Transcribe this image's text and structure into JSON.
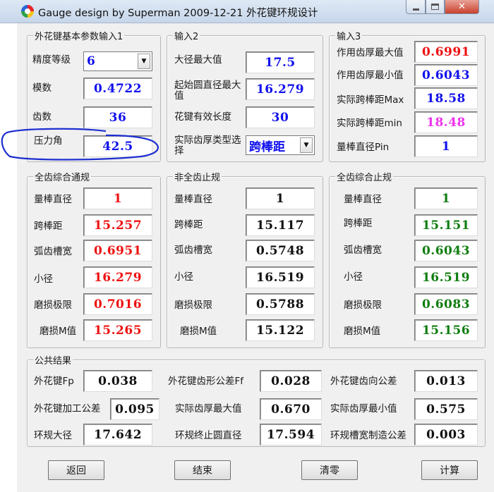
{
  "window": {
    "title": "Gauge design by Superman  2009-12-21  外花键环规设计",
    "minimize_glyph": "",
    "close_glyph": "✕"
  },
  "colors": {
    "blue": "#1010ee",
    "red": "#ee1111",
    "magenta": "#ee33ee",
    "green": "#0f7d0f",
    "annotation": "#1d2fd0"
  },
  "input1": {
    "legend": "外花键基本参数输入1",
    "precision_label": "精度等级",
    "precision_value": "6",
    "module_label": "模数",
    "module_value": "0.4722",
    "teeth_label": "齿数",
    "teeth_value": "36",
    "pressure_label": "压力角",
    "pressure_value": "42.5"
  },
  "input2": {
    "legend": "输入2",
    "major_dia_label": "大径最大值",
    "major_dia_value": "17.5",
    "start_circle_label": "起始圆直径最大值",
    "start_circle_value": "16.279",
    "length_label": "花键有效长度",
    "length_value": "30",
    "thickness_type_label": "实际齿厚类型选择",
    "thickness_type_value": "跨棒距"
  },
  "input3": {
    "legend": "输入3",
    "thick_max_label": "作用齿厚最大值",
    "thick_max_value": "0.6991",
    "thick_min_label": "作用齿厚最小值",
    "thick_min_value": "0.6043",
    "span_max_label": "实际跨棒距Max",
    "span_max_value": "18.58",
    "span_min_label": "实际跨棒距min",
    "span_min_value": "18.48",
    "pin_label": "量棒直径Pin",
    "pin_value": "1"
  },
  "go_full": {
    "legend": "全齿综合通规",
    "rows": [
      {
        "label": "量棒直径",
        "value": "1"
      },
      {
        "label": "跨棒距",
        "value": "15.257"
      },
      {
        "label": "弧齿槽宽",
        "value": "0.6951"
      },
      {
        "label": "小径",
        "value": "16.279"
      },
      {
        "label": "磨损极限",
        "value": "0.7016"
      },
      {
        "label": "磨损M值",
        "value": "15.265"
      }
    ]
  },
  "nogo_partial": {
    "legend": "非全齿止规",
    "rows": [
      {
        "label": "量棒直径",
        "value": "1"
      },
      {
        "label": "跨棒距",
        "value": "15.117"
      },
      {
        "label": "弧齿槽宽",
        "value": "0.5748"
      },
      {
        "label": "小径",
        "value": "16.519"
      },
      {
        "label": "磨损极限",
        "value": "0.5788"
      },
      {
        "label": "磨损M值",
        "value": "15.122"
      }
    ]
  },
  "nogo_full": {
    "legend": "全齿综合止规",
    "rows": [
      {
        "label": "量棒直径",
        "value": "1"
      },
      {
        "label": "跨棒距",
        "value": "15.151"
      },
      {
        "label": "弧齿槽宽",
        "value": "0.6043"
      },
      {
        "label": "小径",
        "value": "16.519"
      },
      {
        "label": "磨损极限",
        "value": "0.6083"
      },
      {
        "label": "磨损M值",
        "value": "15.156"
      }
    ]
  },
  "common": {
    "legend": "公共结果",
    "fp_label": "外花键Fp",
    "fp_value": "0.038",
    "ff_label": "外花键齿形公差Ff",
    "ff_value": "0.028",
    "dir_label": "外花键齿向公差",
    "dir_value": "0.013",
    "mach_label": "外花键加工公差",
    "mach_value": "0.095",
    "act_max_label": "实际齿厚最大值",
    "act_max_value": "0.670",
    "act_min_label": "实际齿厚最小值",
    "act_min_value": "0.575",
    "ring_major_label": "环规大径",
    "ring_major_value": "17.642",
    "ring_end_label": "环规终止圆直径",
    "ring_end_value": "17.594",
    "slot_tol_label": "环规槽宽制造公差",
    "slot_tol_value": "0.003"
  },
  "buttons": {
    "back": "返回",
    "end": "结束",
    "clear": "清零",
    "calc": "计算"
  }
}
